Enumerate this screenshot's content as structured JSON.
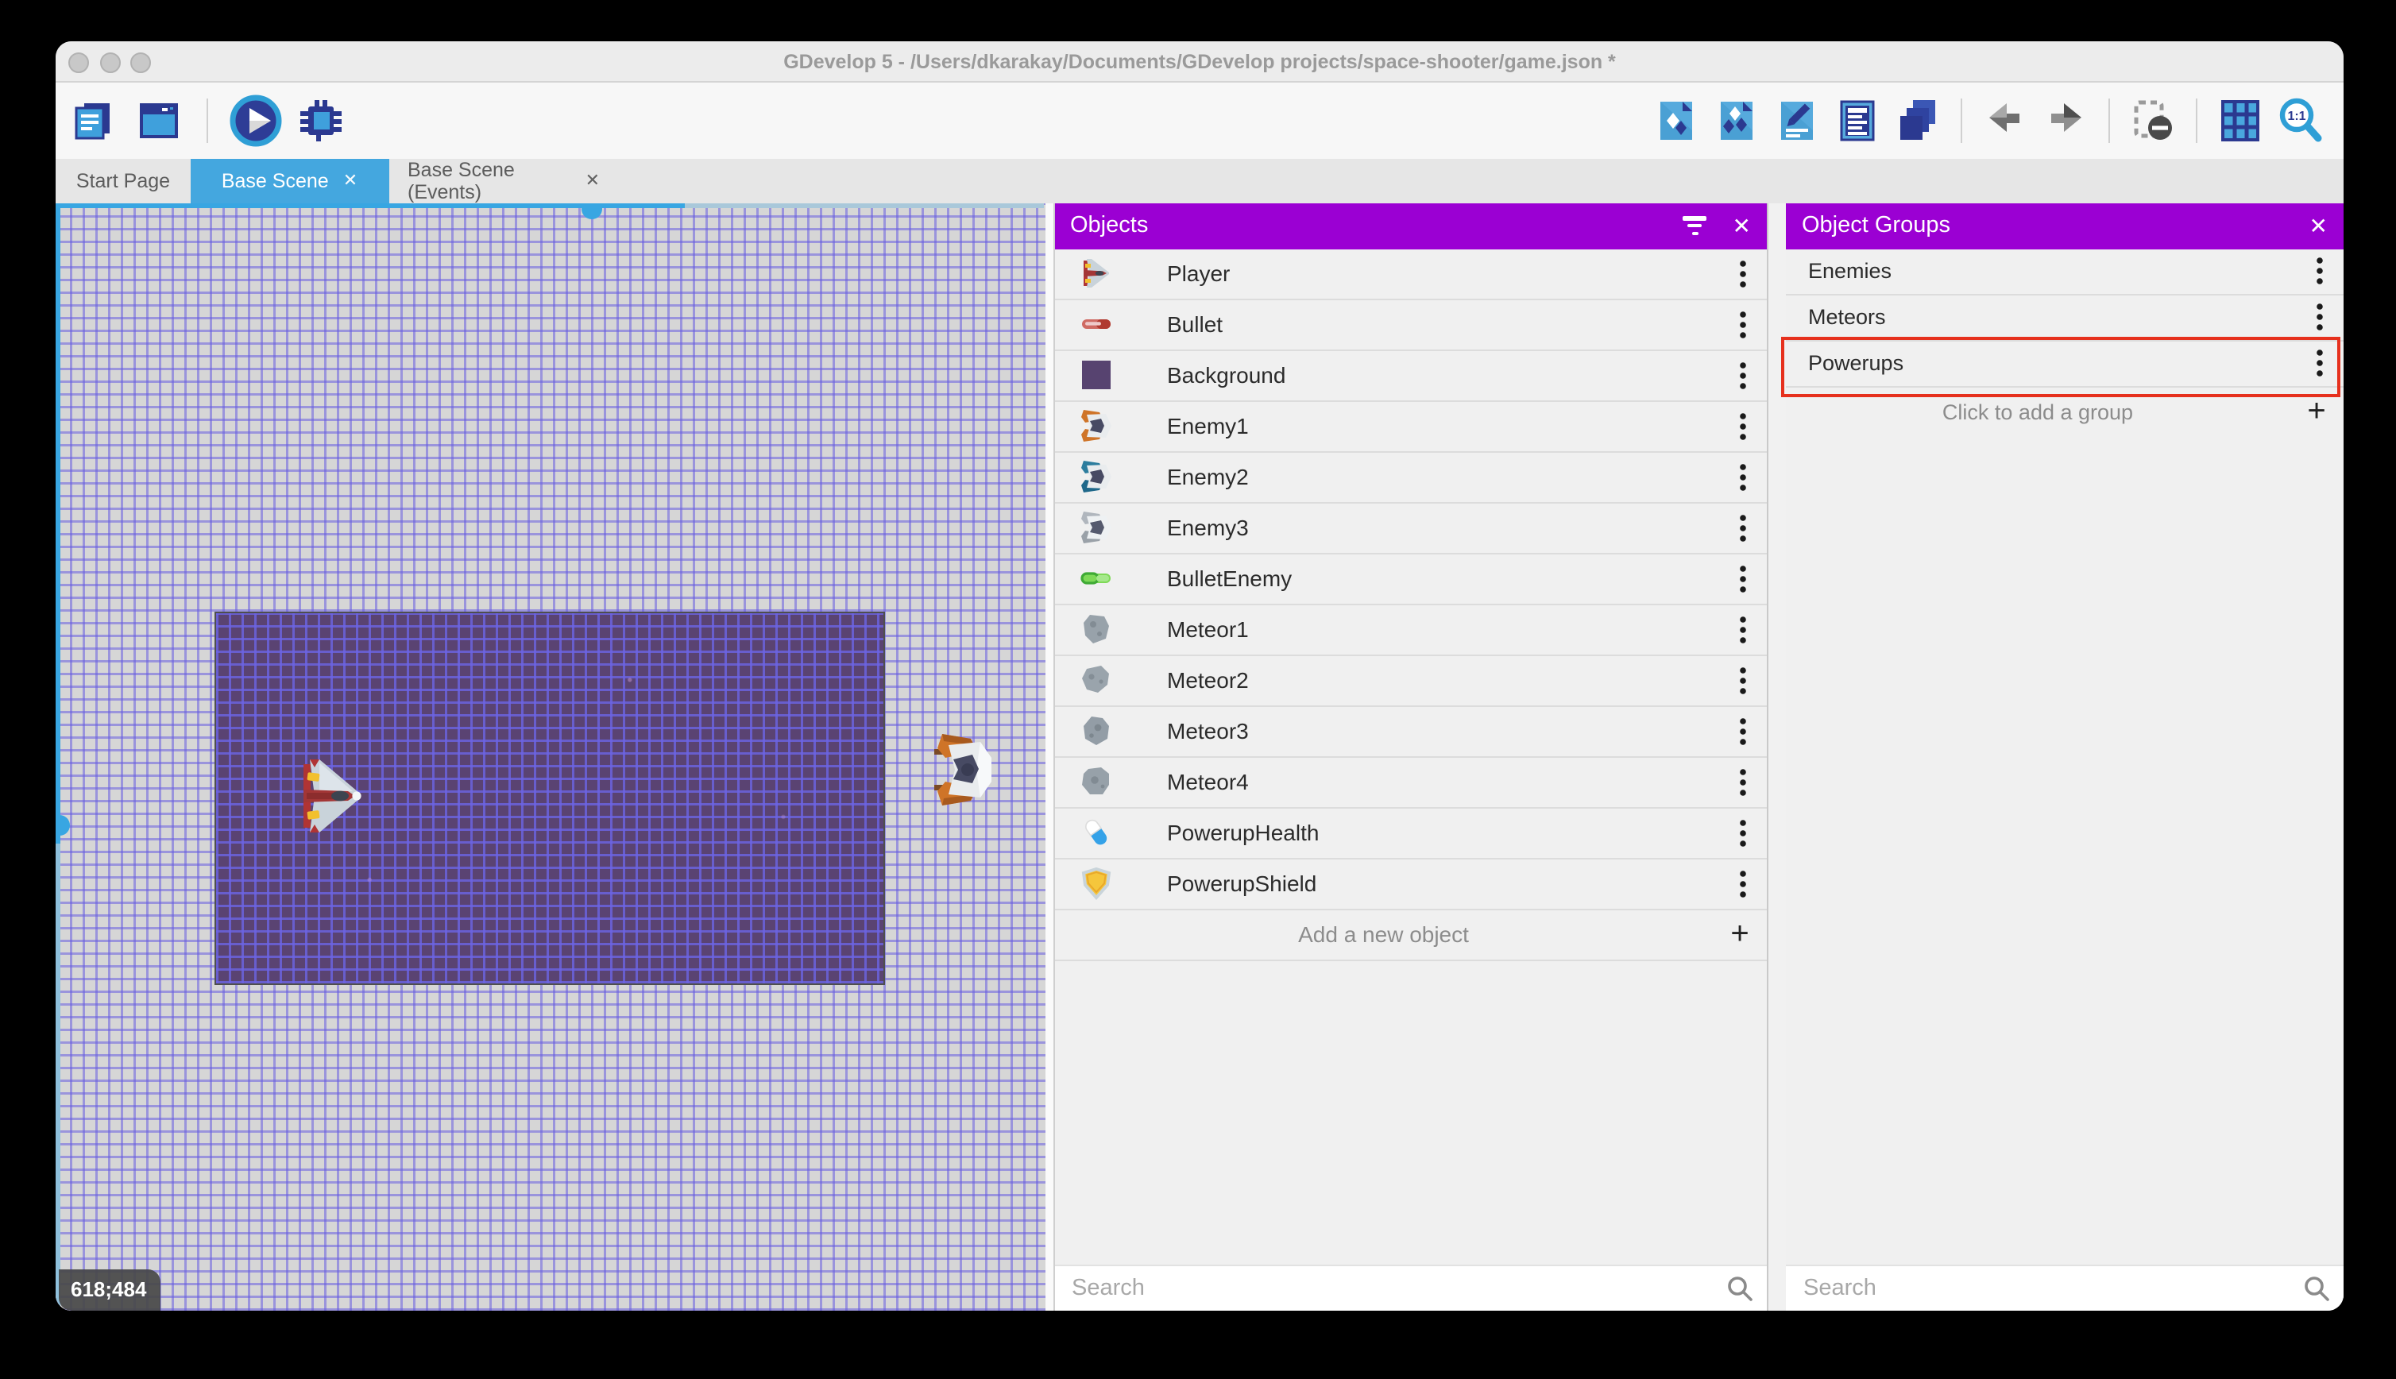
{
  "window": {
    "title": "GDevelop 5 - /Users/dkarakay/Documents/GDevelop projects/space-shooter/game.json *"
  },
  "toolbar": {
    "left": [
      {
        "icon": "project-manager-icon",
        "name": "project-manager-button"
      },
      {
        "icon": "open-window-icon",
        "name": "start-page-button"
      },
      {
        "icon": "divider",
        "name": "toolbar-divider"
      },
      {
        "icon": "play-icon",
        "name": "preview-button"
      },
      {
        "icon": "debug-icon",
        "name": "debug-button"
      }
    ],
    "right": [
      {
        "icon": "objects-icon",
        "name": "toggle-objects-panel-button"
      },
      {
        "icon": "groups-icon",
        "name": "toggle-object-groups-panel-button"
      },
      {
        "icon": "properties-icon",
        "name": "toggle-properties-panel-button"
      },
      {
        "icon": "instances-icon",
        "name": "toggle-instances-list-button"
      },
      {
        "icon": "layers-icon",
        "name": "toggle-layers-panel-button"
      },
      {
        "icon": "divider",
        "name": "toolbar-divider"
      },
      {
        "icon": "undo-icon",
        "name": "undo-button"
      },
      {
        "icon": "redo-icon",
        "name": "redo-button"
      },
      {
        "icon": "divider",
        "name": "toolbar-divider"
      },
      {
        "icon": "mask-icon",
        "name": "toggle-window-mask-button"
      },
      {
        "icon": "divider",
        "name": "toolbar-divider"
      },
      {
        "icon": "grid-icon",
        "name": "toggle-grid-button"
      },
      {
        "icon": "zoom-1-1-icon",
        "name": "zoom-original-button"
      }
    ]
  },
  "tabs": [
    {
      "label": "Start Page",
      "active": false,
      "closable": false
    },
    {
      "label": "Base Scene",
      "active": true,
      "closable": true
    },
    {
      "label": "Base Scene (Events)",
      "active": false,
      "closable": true
    }
  ],
  "canvas": {
    "coordinates": "618;484"
  },
  "objects_panel": {
    "title": "Objects",
    "items": [
      {
        "label": "Player",
        "icon": "player"
      },
      {
        "label": "Bullet",
        "icon": "bullet"
      },
      {
        "label": "Background",
        "icon": "background"
      },
      {
        "label": "Enemy1",
        "icon": "enemy1"
      },
      {
        "label": "Enemy2",
        "icon": "enemy2"
      },
      {
        "label": "Enemy3",
        "icon": "enemy3"
      },
      {
        "label": "BulletEnemy",
        "icon": "bullet-enemy"
      },
      {
        "label": "Meteor1",
        "icon": "meteor1"
      },
      {
        "label": "Meteor2",
        "icon": "meteor2"
      },
      {
        "label": "Meteor3",
        "icon": "meteor3"
      },
      {
        "label": "Meteor4",
        "icon": "meteor4"
      },
      {
        "label": "PowerupHealth",
        "icon": "powerup-health"
      },
      {
        "label": "PowerupShield",
        "icon": "powerup-shield"
      }
    ],
    "add_label": "Add a new object",
    "search_placeholder": "Search"
  },
  "object_groups_panel": {
    "title": "Object Groups",
    "items": [
      {
        "label": "Enemies",
        "highlighted": false
      },
      {
        "label": "Meteors",
        "highlighted": false
      },
      {
        "label": "Powerups",
        "highlighted": true
      }
    ],
    "add_label": "Click to add a group",
    "search_placeholder": "Search"
  },
  "colors": {
    "panel_header": "#9b00d3",
    "active_tab": "#44a7df",
    "selection_blue": "#38a6e2",
    "annotation_red": "#e6301d",
    "background_object": "#5a4372"
  }
}
